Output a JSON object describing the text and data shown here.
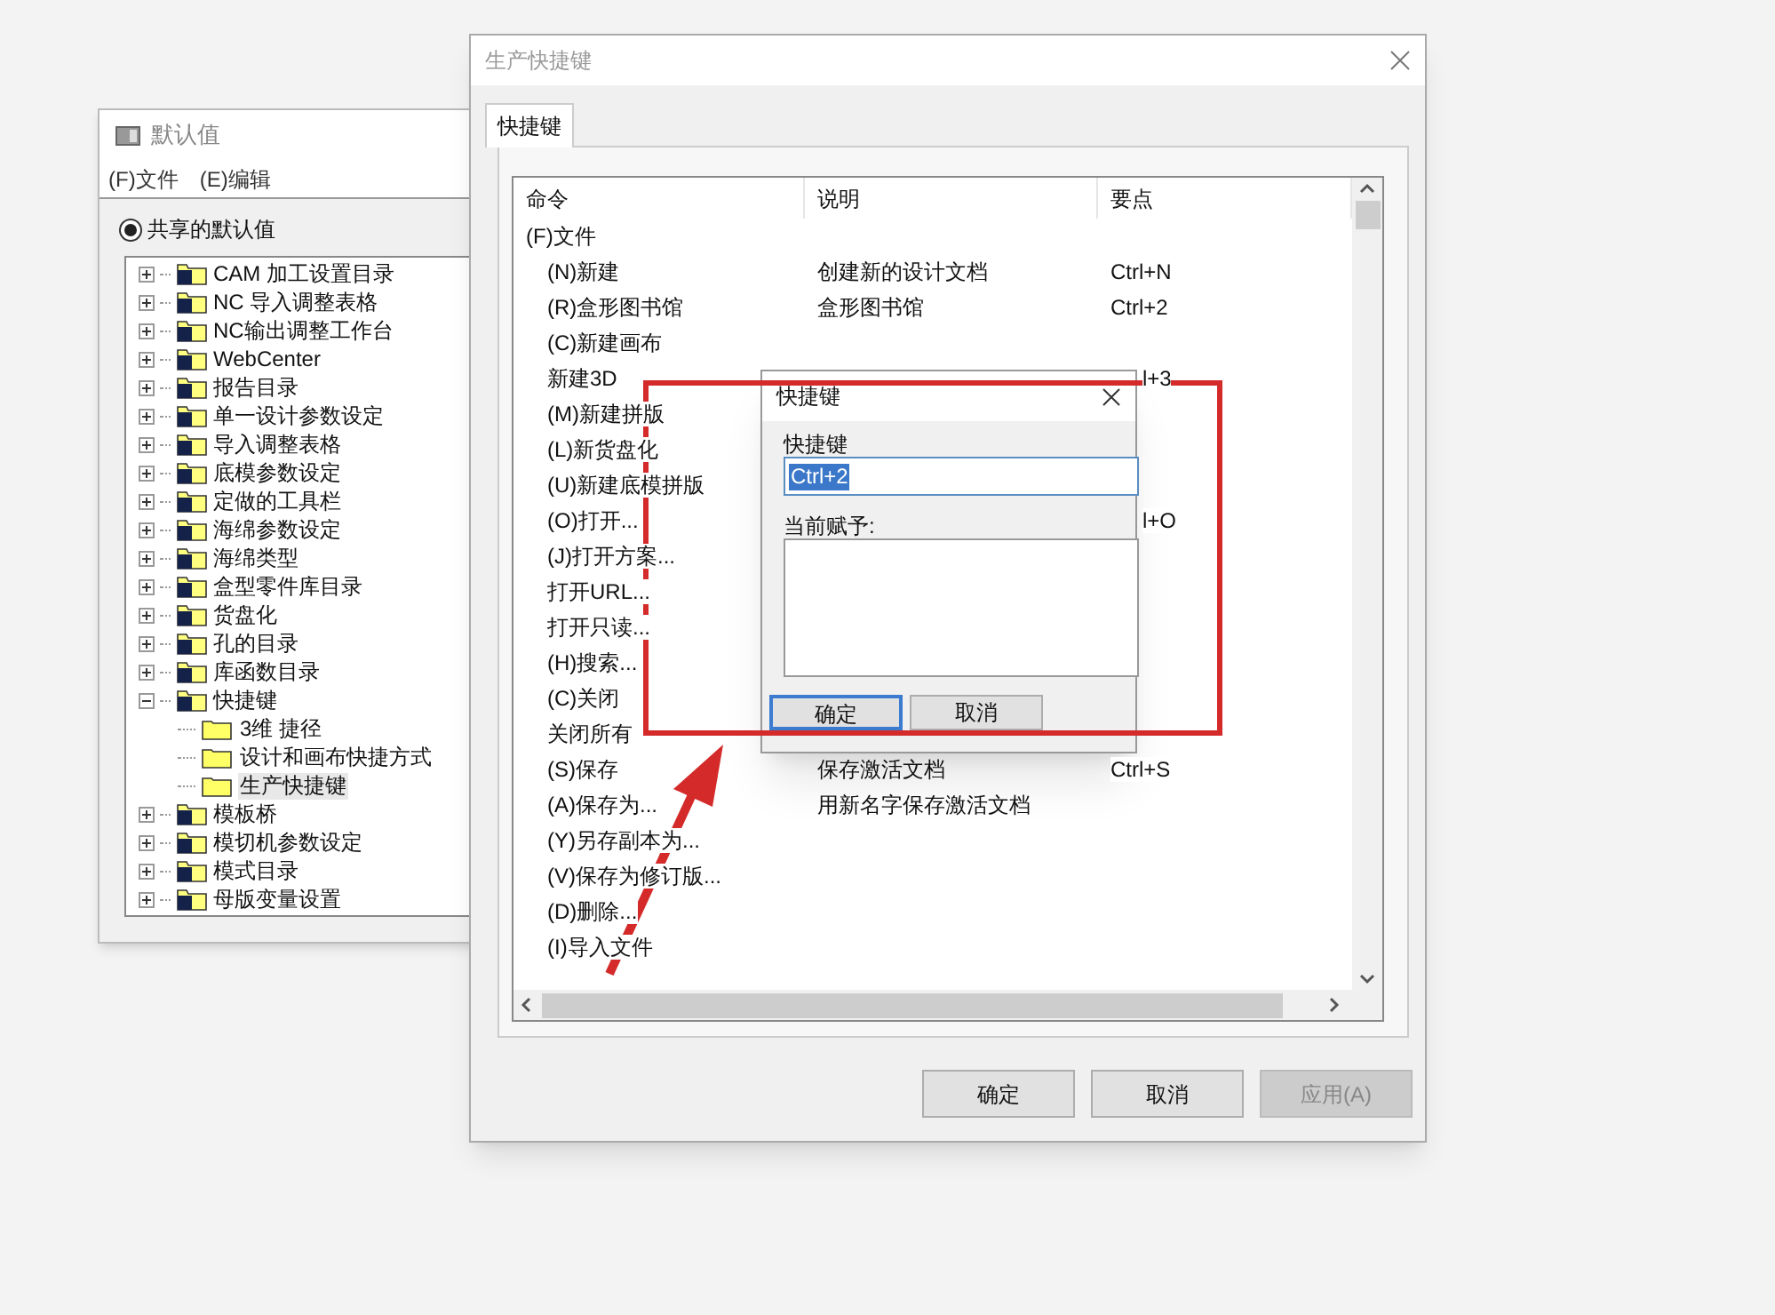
{
  "defaults_window": {
    "title": "默认值",
    "menu": [
      "(F)文件",
      "(E)编辑"
    ],
    "radio": {
      "label": "共享的默认值",
      "selected": true
    },
    "tree": [
      {
        "label": "CAM 加工设置目录",
        "expanded": false
      },
      {
        "label": "NC 导入调整表格",
        "expanded": false
      },
      {
        "label": "NC输出调整工作台",
        "expanded": false
      },
      {
        "label": "WebCenter",
        "expanded": false
      },
      {
        "label": "报告目录",
        "expanded": false
      },
      {
        "label": "单一设计参数设定",
        "expanded": false
      },
      {
        "label": "导入调整表格",
        "expanded": false
      },
      {
        "label": "底模参数设定",
        "expanded": false
      },
      {
        "label": "定做的工具栏",
        "expanded": false
      },
      {
        "label": "海绵参数设定",
        "expanded": false
      },
      {
        "label": "海绵类型",
        "expanded": false
      },
      {
        "label": "盒型零件库目录",
        "expanded": false
      },
      {
        "label": "货盘化",
        "expanded": false
      },
      {
        "label": "孔的目录",
        "expanded": false
      },
      {
        "label": "库函数目录",
        "expanded": false
      },
      {
        "label": "快捷键",
        "expanded": true,
        "children": [
          {
            "label": "3维 捷径",
            "selected": false
          },
          {
            "label": "设计和画布快捷方式",
            "selected": false
          },
          {
            "label": "生产快捷键",
            "selected": true
          }
        ]
      },
      {
        "label": "模板桥",
        "expanded": false
      },
      {
        "label": "模切机参数设定",
        "expanded": false
      },
      {
        "label": "模式目录",
        "expanded": false
      },
      {
        "label": "母版变量设置",
        "expanded": false
      }
    ]
  },
  "main_window": {
    "title": "生产快捷键",
    "tabs": [
      {
        "label": "快捷键",
        "selected": true
      }
    ],
    "table": {
      "columns": [
        "命令",
        "说明",
        "要点"
      ],
      "rows": [
        {
          "kind": "group",
          "command": "(F)文件"
        },
        {
          "kind": "command",
          "command": "(N)新建",
          "description": "创建新的设计文档",
          "key": "Ctrl+N"
        },
        {
          "kind": "command",
          "command": "(R)盒形图书馆",
          "description": "盒形图书馆",
          "key": "Ctrl+2"
        },
        {
          "kind": "command",
          "command": "(C)新建画布"
        },
        {
          "kind": "command",
          "command": "新建3D",
          "key": "l+3",
          "key_clipped": true
        },
        {
          "kind": "command",
          "command": "(M)新建拼版"
        },
        {
          "kind": "command",
          "command": "(L)新货盘化"
        },
        {
          "kind": "command",
          "command": "(U)新建底模拼版"
        },
        {
          "kind": "command",
          "command": "(O)打开...",
          "key": "l+O",
          "key_clipped": true
        },
        {
          "kind": "command",
          "command": "(J)打开方案..."
        },
        {
          "kind": "command",
          "command": "打开URL..."
        },
        {
          "kind": "command",
          "command": "打开只读..."
        },
        {
          "kind": "command",
          "command": "(H)搜索..."
        },
        {
          "kind": "command",
          "command": "(C)关闭"
        },
        {
          "kind": "command",
          "command": "关闭所有"
        },
        {
          "kind": "command",
          "command": "(S)保存",
          "description": "保存激活文档",
          "key": "Ctrl+S"
        },
        {
          "kind": "command",
          "command": "(A)保存为...",
          "description": "用新名字保存激活文档"
        },
        {
          "kind": "command",
          "command": "(Y)另存副本为..."
        },
        {
          "kind": "command",
          "command": "(V)保存为修订版..."
        },
        {
          "kind": "command",
          "command": "(D)删除..."
        },
        {
          "kind": "command",
          "command": "(I)导入文件"
        }
      ]
    },
    "buttons": [
      {
        "label": "确定",
        "disabled": false
      },
      {
        "label": "取消",
        "disabled": false
      },
      {
        "label": "应用(A)",
        "disabled": true
      }
    ]
  },
  "shortcut_dialog": {
    "title": "快捷键",
    "shortcut_label": "快捷键",
    "shortcut_value": "Ctrl+2",
    "assigned_label": "当前赋予:",
    "buttons": [
      {
        "label": "确定",
        "focused": true
      },
      {
        "label": "取消",
        "focused": false
      }
    ]
  }
}
